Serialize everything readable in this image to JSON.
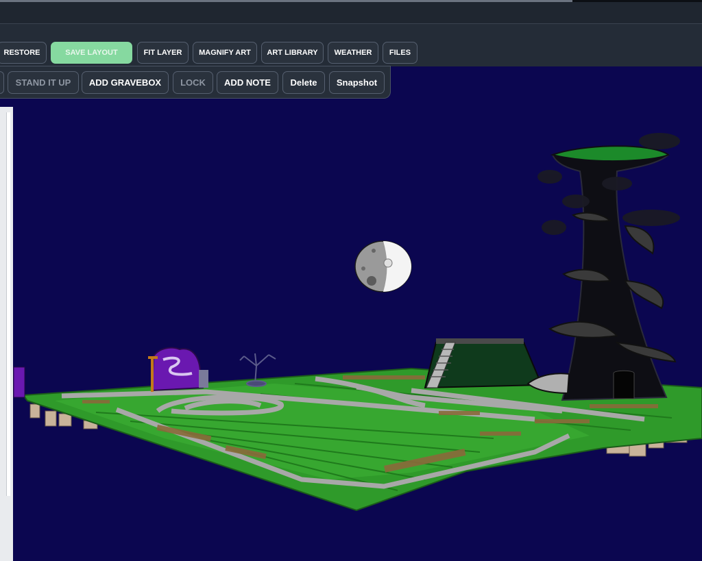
{
  "toolbar": {
    "row1": {
      "restore": "RESTORE",
      "save_layout": "SAVE LAYOUT",
      "fit_layer": "FIT LAYER",
      "magnify_art": "MAGNIFY ART",
      "art_library": "ART LIBRARY",
      "weather": "WEATHER",
      "files": "FILES"
    },
    "row2": {
      "stand_it_up": "STAND IT UP",
      "add_gravebox": "ADD GRAVEBOX",
      "lock": "LOCK",
      "add_note": "ADD NOTE",
      "delete": "Delete",
      "snapshot": "Snapshot"
    }
  },
  "colors": {
    "sky": "#0b0650",
    "grass": "#2f9a2a",
    "accent_save": "#86d9a0",
    "toolbar_bg": "#242c37"
  }
}
